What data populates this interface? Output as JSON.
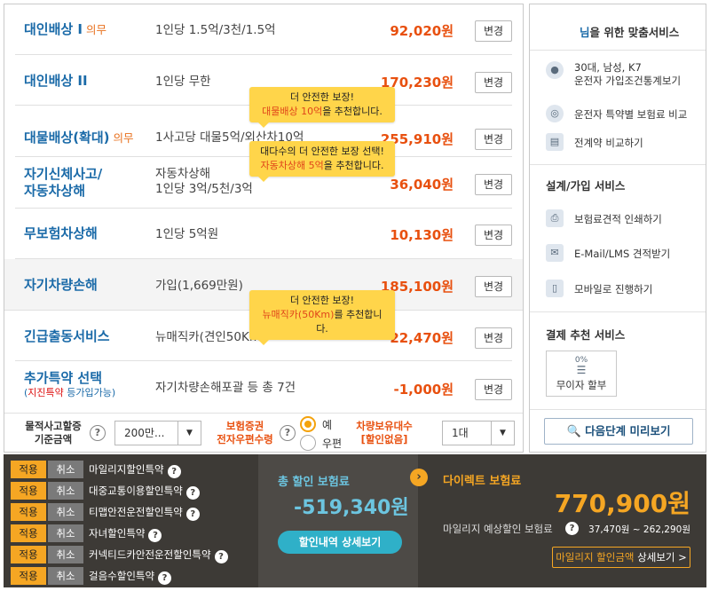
{
  "coverage_rows": [
    {
      "name": "대인배상 I",
      "req": "의무",
      "limit_lines": [
        "1인당 1.5억/3천/1.5억"
      ],
      "price": "92,020원",
      "btn": "변경"
    },
    {
      "name": "대인배상 II",
      "req": "",
      "limit_lines": [
        "1인당 무한"
      ],
      "price": "170,230원",
      "btn": "변경"
    },
    {
      "name": "대물배상(확대)",
      "req": "의무",
      "limit_lines": [
        "1사고당 대물5억/외산차10억"
      ],
      "price": "255,910원",
      "btn": "변경"
    },
    {
      "name_lines": [
        "자기신체사고/",
        "자동차상해"
      ],
      "limit_lines": [
        "자동차상해",
        "1인당 3억/5천/3억"
      ],
      "price": "36,040원",
      "btn": "변경"
    },
    {
      "name": "무보험차상해",
      "req": "",
      "limit_lines": [
        "1인당 5억원"
      ],
      "price": "10,130원",
      "btn": "변경"
    },
    {
      "name": "자기차량손해",
      "req": "",
      "limit_lines": [
        "가입(1,669만원)"
      ],
      "price": "185,100원",
      "btn": "변경"
    },
    {
      "name": "긴급출동서비스",
      "req": "",
      "limit_lines": [
        "뉴매직카(견인50Km)"
      ],
      "price": "22,470원",
      "btn": "변경"
    },
    {
      "name": "추가특약 선택",
      "sub_pre": "(",
      "sub_red": "지진특약",
      "sub_post": " 등가입가능)",
      "limit_lines": [
        "자기차량손해포괄 등 총 7건"
      ],
      "price": "-1,000원",
      "btn": "변경"
    }
  ],
  "tooltips": [
    {
      "line1": "더 안전한 보장!",
      "hl": "대물배상 10억",
      "rest": "을 추천합니다."
    },
    {
      "line1": "대다수의 더 안전한 보장 선택!",
      "hl": "자동차상해 5억",
      "rest": "을 추천합니다."
    },
    {
      "line1": "더 안전한 보장!",
      "hl": "뉴매직카(50Km)",
      "rest": "를 추천합니다."
    }
  ],
  "options": {
    "property_limit_label_1": "물적사고할증",
    "property_limit_label_2": "기준금액",
    "property_limit_value": "200만...",
    "e_policy_label_1": "보험증권",
    "e_policy_label_2": "전자우편수령",
    "radio_yes": "예",
    "radio_post": "우편",
    "vehicles_label_1": "차량보유대수",
    "vehicles_label_2": "[할인없음]",
    "vehicles_value": "1대",
    "help": "?"
  },
  "service": {
    "header_prefix": "님",
    "header_suffix": "을 위한 맞춤서비스",
    "profile_line1": "30대, 남성, K7",
    "profile_line2": "운전자 가입조건통계보기",
    "compare_premium": "운전자 특약별 보험료 비교",
    "compare_all": "전계약 비교하기",
    "design_title": "설계/가입 서비스",
    "print_quote": "보험료견적 인쇄하기",
    "email_quote": "E-Mail/LMS 견적받기",
    "mobile_continue": "모바일로 진행하기",
    "payment_title": "결제 추천 서비스",
    "no_interest_pct": "0%",
    "no_interest": "무이자 할부",
    "preview_btn": "다음단계 미리보기"
  },
  "discounts": [
    {
      "apply": "적용",
      "cancel": "취소",
      "name": "마일리지할인특약"
    },
    {
      "apply": "적용",
      "cancel": "취소",
      "name": "대중교통이용할인특약"
    },
    {
      "apply": "적용",
      "cancel": "취소",
      "name": "티맵안전운전할인특약"
    },
    {
      "apply": "적용",
      "cancel": "취소",
      "name": "자녀할인특약"
    },
    {
      "apply": "적용",
      "cancel": "취소",
      "name": "커넥티드카안전운전할인특약"
    },
    {
      "apply": "적용",
      "cancel": "취소",
      "name": "걸음수할인특약"
    }
  ],
  "summary": {
    "total_discount_label": "총 할인 보험료",
    "total_discount_value": "-519,340원",
    "discount_detail_btn": "할인내역 상세보기",
    "direct_label": "다이렉트 보험료",
    "direct_value": "770,900원",
    "mileage_label": "마일리지 예상할인 보험료",
    "mileage_range": "37,470원 ~ 262,290원",
    "mileage_btn_hl": "마일리지 할인금액",
    "mileage_btn_rest": " 상세보기 >"
  },
  "colors": {
    "accent_orange": "#e8500f",
    "link_blue": "#1a6aa8",
    "apply_yellow": "#f5a623",
    "tooltip": "#ffd54a",
    "dark_bar": "#3d3a36"
  }
}
